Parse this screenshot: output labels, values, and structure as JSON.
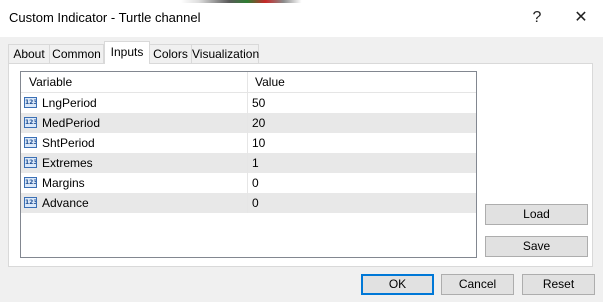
{
  "window": {
    "title": "Custom Indicator - Turtle channel",
    "help_label": "?",
    "close_label": "✕"
  },
  "tabs": [
    {
      "label": "About"
    },
    {
      "label": "Common"
    },
    {
      "label": "Inputs"
    },
    {
      "label": "Colors"
    },
    {
      "label": "Visualization"
    }
  ],
  "active_tab": "Inputs",
  "inputs_table": {
    "headers": {
      "variable": "Variable",
      "value": "Value"
    },
    "icon_text": "123",
    "rows": [
      {
        "variable": "LngPeriod",
        "value": "50"
      },
      {
        "variable": "MedPeriod",
        "value": "20"
      },
      {
        "variable": "ShtPeriod",
        "value": "10"
      },
      {
        "variable": "Extremes",
        "value": "1"
      },
      {
        "variable": "Margins",
        "value": "0"
      },
      {
        "variable": "Advance",
        "value": "0"
      }
    ]
  },
  "side_buttons": {
    "load_label": "Load",
    "save_label": "Save"
  },
  "footer_buttons": {
    "ok_label": "OK",
    "cancel_label": "Cancel",
    "reset_label": "Reset"
  },
  "colors": {
    "accent": "#0078d7",
    "row_alt": "#e8e8e8",
    "button_bg": "#e1e1e1"
  }
}
